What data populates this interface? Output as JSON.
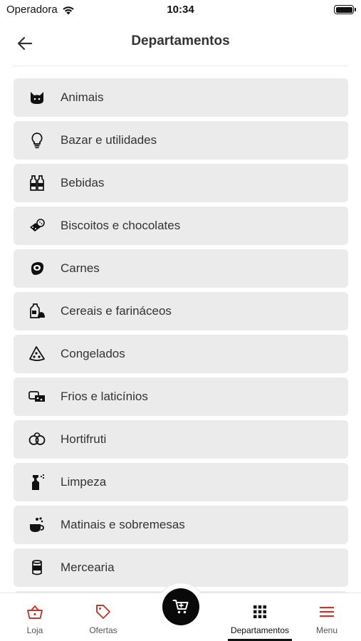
{
  "status_bar": {
    "carrier": "Operadora",
    "time": "10:34"
  },
  "header": {
    "title": "Departamentos",
    "back_icon": "arrow-left-icon"
  },
  "departments": [
    {
      "label": "Animais",
      "icon": "cat-icon"
    },
    {
      "label": "Bazar e utilidades",
      "icon": "lightbulb-icon"
    },
    {
      "label": "Bebidas",
      "icon": "bottles-icon"
    },
    {
      "label": "Biscoitos e chocolates",
      "icon": "cookie-icon"
    },
    {
      "label": "Carnes",
      "icon": "steak-icon"
    },
    {
      "label": "Cereais e farináceos",
      "icon": "grain-bag-icon"
    },
    {
      "label": "Congelados",
      "icon": "pizza-slice-icon"
    },
    {
      "label": "Frios e laticínios",
      "icon": "cheese-icon"
    },
    {
      "label": "Hortifruti",
      "icon": "fruits-icon"
    },
    {
      "label": "Limpeza",
      "icon": "spray-bottle-icon"
    },
    {
      "label": "Matinais e sobremesas",
      "icon": "cup-icon"
    },
    {
      "label": "Mercearia",
      "icon": "can-icon"
    }
  ],
  "tabbar": {
    "loja": "Loja",
    "ofertas": "Ofertas",
    "departamentos": "Departamentos",
    "menu": "Menu",
    "active_tab": "Departamentos"
  },
  "colors": {
    "accent": "#c0392b",
    "item_bg": "#ebebeb",
    "text": "#333333",
    "fab": "#0a0a0a"
  }
}
